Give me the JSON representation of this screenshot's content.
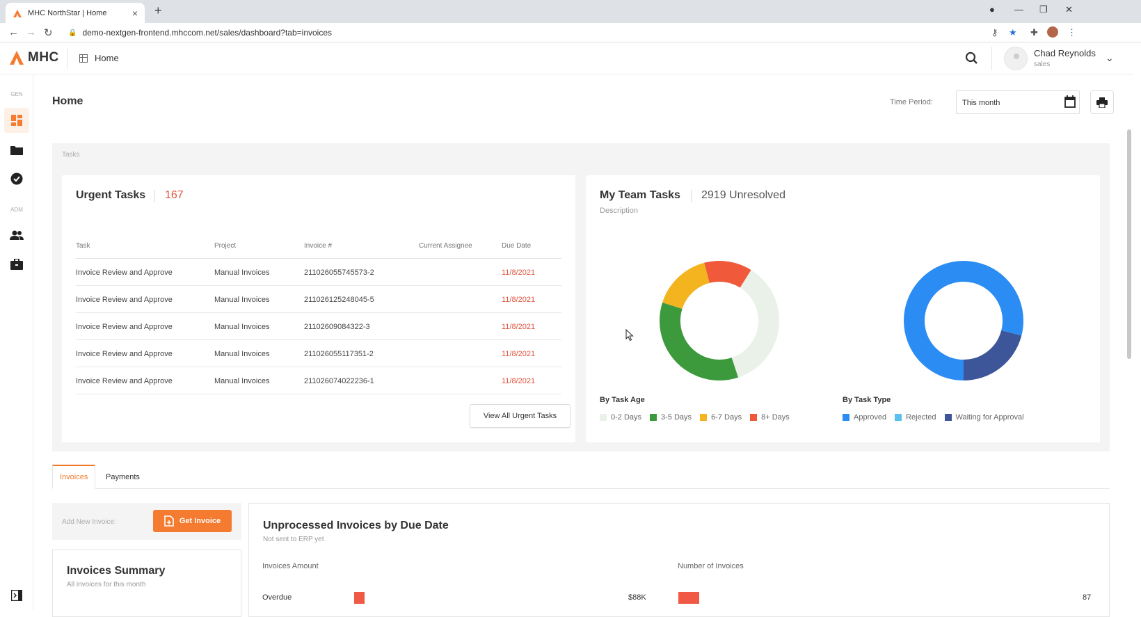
{
  "browser": {
    "tab_title": "MHC NorthStar | Home",
    "tab_close": "×",
    "new_tab": "+",
    "url": "demo-nextgen-frontend.mhccom.net/sales/dashboard?tab=invoices"
  },
  "header": {
    "logo": "MHC",
    "breadcrumb": "Home",
    "user_name": "Chad Reynolds",
    "user_role": "sales"
  },
  "sidebar": {
    "sections": [
      "GEN",
      "ADM"
    ]
  },
  "page": {
    "title": "Home",
    "time_period_label": "Time Period:",
    "time_period_value": "This month",
    "tasks_label": "Tasks"
  },
  "urgent_tasks": {
    "title": "Urgent Tasks",
    "count": "167",
    "columns": [
      "Task",
      "Project",
      "Invoice #",
      "Current Assignee",
      "Due Date"
    ],
    "rows": [
      {
        "task": "Invoice Review and Approve",
        "project": "Manual Invoices",
        "invoice": "211026055745573-2",
        "assignee": "",
        "due": "11/8/2021"
      },
      {
        "task": "Invoice Review and Approve",
        "project": "Manual Invoices",
        "invoice": "211026125248045-5",
        "assignee": "",
        "due": "11/8/2021"
      },
      {
        "task": "Invoice Review and Approve",
        "project": "Manual Invoices",
        "invoice": "21102609084322-3",
        "assignee": "",
        "due": "11/8/2021"
      },
      {
        "task": "Invoice Review and Approve",
        "project": "Manual Invoices",
        "invoice": "211026055117351-2",
        "assignee": "",
        "due": "11/8/2021"
      },
      {
        "task": "Invoice Review and Approve",
        "project": "Manual Invoices",
        "invoice": "211026074022236-1",
        "assignee": "",
        "due": "11/8/2021"
      }
    ],
    "view_all": "View All Urgent Tasks"
  },
  "team_tasks": {
    "title": "My Team Tasks",
    "unresolved": "2919 Unresolved",
    "description": "Description",
    "by_age": {
      "label": "By Task Age",
      "legend": [
        {
          "name": "0-2 Days",
          "color": "#e9f1e9",
          "fraction": 0.36
        },
        {
          "name": "3-5 Days",
          "color": "#3c9a3c",
          "fraction": 0.35
        },
        {
          "name": "6-7 Days",
          "color": "#f3b41f",
          "fraction": 0.16
        },
        {
          "name": "8+ Days",
          "color": "#f05a3b",
          "fraction": 0.13
        }
      ]
    },
    "by_type": {
      "label": "By Task Type",
      "legend": [
        {
          "name": "Approved",
          "color": "#2b8cf3",
          "fraction": 0.79
        },
        {
          "name": "Rejected",
          "color": "#5bc0f0",
          "fraction": 0.0
        },
        {
          "name": "Waiting for Approval",
          "color": "#3d5599",
          "fraction": 0.21
        }
      ]
    }
  },
  "bottom_tabs": [
    "Invoices",
    "Payments"
  ],
  "add_invoice": {
    "label": "Add New Invoice:",
    "button": "Get Invoice"
  },
  "summary": {
    "title": "Invoices Summary",
    "subtitle": "All invoices for this month"
  },
  "unprocessed": {
    "title": "Unprocessed Invoices by Due Date",
    "subtitle": "Not sent to ERP yet",
    "col_amount": "Invoices Amount",
    "col_number": "Number of Invoices",
    "rows": [
      {
        "label": "Overdue",
        "amount": "$88K",
        "count": "87"
      }
    ]
  },
  "colors": {
    "accent": "#f47b30",
    "danger": "#e0533d"
  }
}
